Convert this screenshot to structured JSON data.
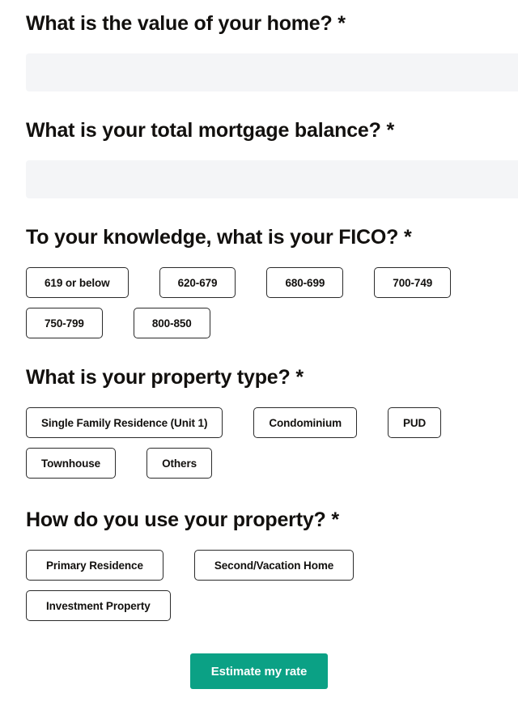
{
  "form": {
    "required_marker": "*",
    "sections": [
      {
        "id": "home-value",
        "heading": "What is the value of your home? *",
        "type": "text-input",
        "value": "",
        "placeholder": ""
      },
      {
        "id": "mortgage-balance",
        "heading": "What is your total mortgage balance? *",
        "type": "text-input",
        "value": "",
        "placeholder": ""
      },
      {
        "id": "fico",
        "heading": "To your knowledge, what is your FICO? *",
        "type": "choice",
        "options": [
          "619 or below",
          "620-679",
          "680-699",
          "700-749",
          "750-799",
          "800-850"
        ]
      },
      {
        "id": "property-type",
        "heading": "What is your property type? *",
        "type": "choice",
        "options": [
          "Single Family Residence (Unit 1)",
          "Condominium",
          "PUD",
          "Townhouse",
          "Others"
        ]
      },
      {
        "id": "property-use",
        "heading": "How do you use your property? *",
        "type": "choice",
        "options": [
          "Primary Residence",
          "Second/Vacation Home",
          "Investment Property"
        ]
      }
    ],
    "submit_label": "Estimate my rate"
  },
  "colors": {
    "accent": "#0ba185",
    "input_background": "#f4f5f7",
    "text": "#12100e",
    "button_border": "#2b2b2b",
    "submit_text": "#ffffff"
  }
}
